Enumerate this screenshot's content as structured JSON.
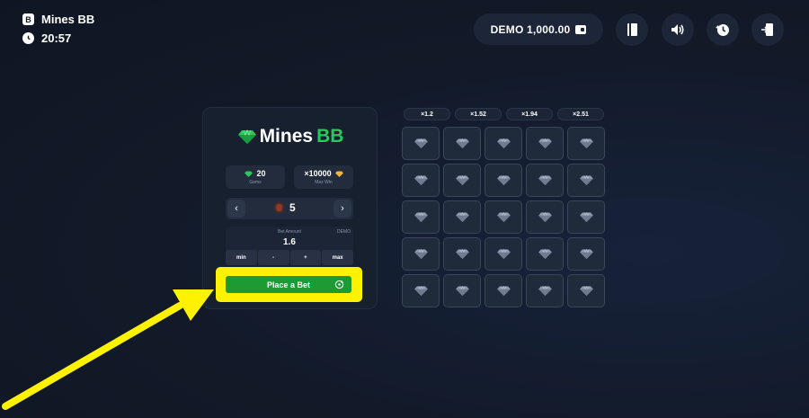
{
  "header": {
    "game_badge": "B",
    "game_name": "Mines BB",
    "time": "20:57"
  },
  "balance": {
    "text": "DEMO 1,000.00"
  },
  "toolbar": {
    "icons": [
      "book-icon",
      "sound-icon",
      "history-icon",
      "exit-icon"
    ]
  },
  "panel": {
    "logo_part1": "Mines",
    "logo_part2": "BB",
    "gems": {
      "value": "20",
      "label": "Gems"
    },
    "max_win": {
      "value": "×10000",
      "label": "Max Win"
    },
    "mines": {
      "prev": "‹",
      "next": "›",
      "value": "5"
    },
    "bet": {
      "label": "Bet Amount",
      "currency": "DEMO",
      "value": "1.6",
      "buttons": [
        "min",
        "-",
        "+",
        "max"
      ]
    },
    "place_bet_label": "Place a Bet"
  },
  "multipliers": [
    "×1.2",
    "×1.52",
    "×1.94",
    "×2.51"
  ],
  "grid": {
    "rows": 5,
    "cols": 5
  },
  "colors": {
    "background": "#121a29",
    "accent_green": "#26c95b",
    "button_green": "#1e9a34",
    "highlight_yellow": "#fff200"
  }
}
